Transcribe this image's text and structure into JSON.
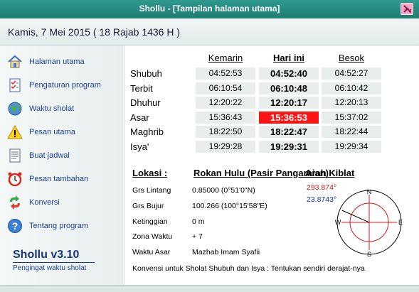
{
  "window": {
    "title": "Shollu - [Tampilan halaman utama]"
  },
  "header": {
    "date": "Kamis, 7 Mei 2015 ( 18 Rajab 1436 H )"
  },
  "sidebar": {
    "items": [
      {
        "label": "Halaman utama",
        "icon": "home-icon"
      },
      {
        "label": "Pengaturan program",
        "icon": "checklist-icon"
      },
      {
        "label": "Waktu sholat",
        "icon": "globe-icon"
      },
      {
        "label": "Pesan utama",
        "icon": "warning-icon"
      },
      {
        "label": "Buat jadwal",
        "icon": "document-icon"
      },
      {
        "label": "Pesan tambahan",
        "icon": "alarm-clock-icon"
      },
      {
        "label": "Konversi",
        "icon": "convert-icon"
      },
      {
        "label": "Tentang program",
        "icon": "help-icon"
      }
    ],
    "brand_name": "Shollu v3.10",
    "brand_tagline": "Pengingat waktu sholat"
  },
  "schedule": {
    "columns": [
      "Kemarin",
      "Hari ini",
      "Besok"
    ],
    "rows": [
      {
        "name": "Shubuh",
        "times": [
          "04:52:53",
          "04:52:40",
          "04:52:27"
        ]
      },
      {
        "name": "Terbit",
        "times": [
          "06:10:54",
          "06:10:48",
          "06:10:42"
        ]
      },
      {
        "name": "Dhuhur",
        "times": [
          "12:20:22",
          "12:20:17",
          "12:20:13"
        ]
      },
      {
        "name": "Asar",
        "times": [
          "15:36:43",
          "15:36:53",
          "15:37:02"
        ]
      },
      {
        "name": "Maghrib",
        "times": [
          "18:22:50",
          "18:22:47",
          "18:22:44"
        ]
      },
      {
        "name": "Isya'",
        "times": [
          "19:29:28",
          "19:29:31",
          "19:29:34"
        ]
      }
    ],
    "highlight_color": "#ff1414"
  },
  "location": {
    "title": "Lokasi :",
    "name": "Rokan Hulu (Pasir Pangaraian)",
    "fields": [
      {
        "label": "Grs Lintang",
        "value": "0.85000 (0°51'0\"N)"
      },
      {
        "label": "Grs Bujur",
        "value": "100.266 (100°15'58\"E)"
      },
      {
        "label": "Ketinggian",
        "value": "0 m"
      },
      {
        "label": "Zona Waktu",
        "value": "+ 7"
      },
      {
        "label": "Waktu Asar",
        "value": "Mazhab Imam Syafii"
      }
    ],
    "footnote": "Konvensi untuk Sholat Shubuh dan Isya : Tentukan sendiri derajat-nya"
  },
  "kiblat": {
    "title": "Arah Kiblat",
    "azimuth_label": "293.874°",
    "elevation_label": "23.8743°",
    "azimuth": 293.874,
    "compass_letters": {
      "n": "N",
      "e": "E",
      "s": "S",
      "w": "W"
    }
  }
}
